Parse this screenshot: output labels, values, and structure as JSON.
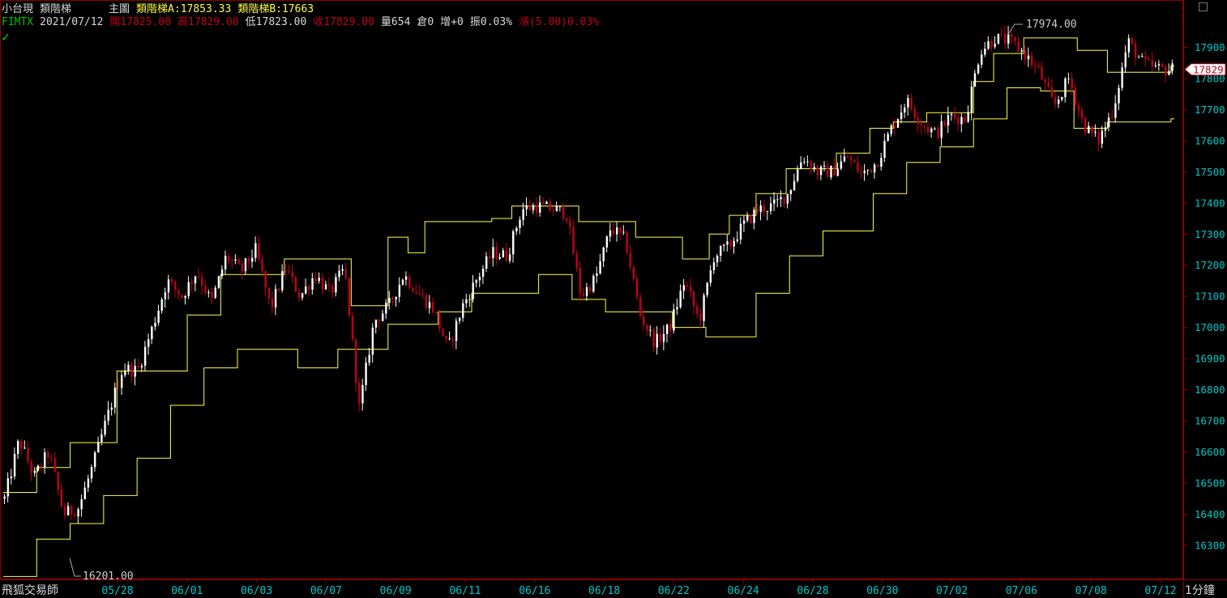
{
  "header": {
    "product": "小台現",
    "indicator": "類階梯",
    "pane": "主圖",
    "ladder_a": "類階梯A:17853.33",
    "ladder_b": "類階梯B:17663"
  },
  "quote": {
    "symbol": "FIMTX",
    "date": "2021/07/12",
    "open": "開17825.00",
    "high": "高17829.00",
    "low": "低17823.00",
    "close": "收17829.00",
    "volume": "量654",
    "open_interest": "倉0",
    "oi_change": "增+0",
    "amplitude": "振0.03%",
    "change": "漲(5.00)0.03%"
  },
  "footer": {
    "brand": "飛狐交易師",
    "period": "1分鐘"
  },
  "colors": {
    "background": "#000000",
    "candle_up": "#ffffff",
    "candle_down": "#c0001a",
    "ladder": "#ffff40",
    "axis_text": "#00c8c8",
    "grid": "#7a0000"
  },
  "chart_data": {
    "type": "candlestick",
    "xlabels": [
      "05/28",
      "06/01",
      "06/03",
      "06/07",
      "06/09",
      "06/11",
      "06/16",
      "06/18",
      "06/22",
      "06/24",
      "06/28",
      "06/30",
      "07/02",
      "07/06",
      "07/08",
      "07/12"
    ],
    "yticks": [
      16300,
      16400,
      16500,
      16600,
      16700,
      16800,
      16900,
      17000,
      17100,
      17200,
      17300,
      17400,
      17500,
      17600,
      17700,
      17800,
      17900
    ],
    "ylim": [
      16201,
      17974
    ],
    "annotations": {
      "high_label": "17974.00",
      "low_label": "16201.00",
      "last_price": "17829"
    },
    "price_path": [
      16450,
      16640,
      16520,
      16600,
      16400,
      16420,
      16560,
      16720,
      16870,
      16860,
      17000,
      17150,
      17100,
      17180,
      17080,
      17230,
      17180,
      17250,
      17060,
      17190,
      17100,
      17170,
      17110,
      17190,
      16740,
      17020,
      17070,
      17170,
      17110,
      17060,
      16930,
      17070,
      17160,
      17240,
      17230,
      17380,
      17390,
      17380,
      17370,
      17100,
      17160,
      17320,
      17280,
      17040,
      16950,
      17000,
      17150,
      17020,
      17230,
      17260,
      17330,
      17380,
      17390,
      17430,
      17550,
      17500,
      17500,
      17550,
      17490,
      17530,
      17640,
      17730,
      17660,
      17620,
      17680,
      17670,
      17890,
      17930,
      17920,
      17880,
      17820,
      17710,
      17800,
      17650,
      17600,
      17700,
      17920,
      17850,
      17830,
      17829
    ],
    "ladder_a": [
      [
        0,
        16470
      ],
      [
        10,
        16550
      ],
      [
        20,
        16630
      ],
      [
        34,
        16860
      ],
      [
        55,
        17040
      ],
      [
        65,
        17170
      ],
      [
        84,
        17220
      ],
      [
        97,
        17220
      ],
      [
        104,
        17070
      ],
      [
        115,
        17290
      ],
      [
        121,
        17240
      ],
      [
        126,
        17340
      ],
      [
        146,
        17350
      ],
      [
        152,
        17390
      ],
      [
        172,
        17340
      ],
      [
        189,
        17290
      ],
      [
        203,
        17220
      ],
      [
        211,
        17300
      ],
      [
        217,
        17360
      ],
      [
        225,
        17430
      ],
      [
        234,
        17510
      ],
      [
        249,
        17560
      ],
      [
        259,
        17640
      ],
      [
        266,
        17660
      ],
      [
        276,
        17690
      ],
      [
        290,
        17790
      ],
      [
        296,
        17880
      ],
      [
        305,
        17930
      ],
      [
        321,
        17890
      ],
      [
        330,
        17820
      ],
      [
        349,
        17840
      ]
    ],
    "ladder_b": [
      [
        0,
        16200
      ],
      [
        10,
        16320
      ],
      [
        20,
        16370
      ],
      [
        30,
        16460
      ],
      [
        40,
        16580
      ],
      [
        50,
        16750
      ],
      [
        60,
        16870
      ],
      [
        70,
        16930
      ],
      [
        88,
        16870
      ],
      [
        100,
        16930
      ],
      [
        115,
        17010
      ],
      [
        130,
        17050
      ],
      [
        140,
        17110
      ],
      [
        160,
        17170
      ],
      [
        170,
        17090
      ],
      [
        180,
        17050
      ],
      [
        200,
        17000
      ],
      [
        210,
        16970
      ],
      [
        225,
        17110
      ],
      [
        235,
        17230
      ],
      [
        245,
        17310
      ],
      [
        260,
        17430
      ],
      [
        270,
        17530
      ],
      [
        280,
        17580
      ],
      [
        290,
        17670
      ],
      [
        300,
        17770
      ],
      [
        310,
        17760
      ],
      [
        320,
        17640
      ],
      [
        330,
        17660
      ],
      [
        349,
        17670
      ]
    ]
  }
}
